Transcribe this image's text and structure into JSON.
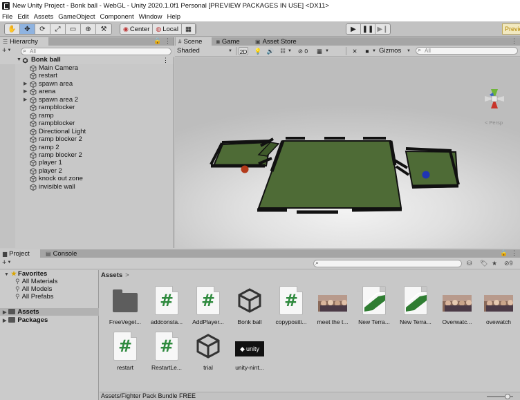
{
  "window": {
    "title": "New Unity Project - Bonk ball - WebGL - Unity 2020.1.0f1 Personal [PREVIEW PACKAGES IN USE] <DX11>"
  },
  "menu": [
    "File",
    "Edit",
    "Assets",
    "GameObject",
    "Component",
    "Window",
    "Help"
  ],
  "toolbar": {
    "center_label": "Center",
    "local_label": "Local",
    "preview_label": "Previe"
  },
  "hierarchy": {
    "tab_label": "Hierarchy",
    "search_placeholder": "All",
    "scene_name": "Bonk ball",
    "items": [
      {
        "name": "Main Camera",
        "expandable": false
      },
      {
        "name": "restart",
        "expandable": false
      },
      {
        "name": "spawn area",
        "expandable": true
      },
      {
        "name": "arena",
        "expandable": true
      },
      {
        "name": "spawn area 2",
        "expandable": true
      },
      {
        "name": "rampblocker",
        "expandable": false
      },
      {
        "name": "ramp",
        "expandable": false
      },
      {
        "name": "rampblocker",
        "expandable": false
      },
      {
        "name": "Directional Light",
        "expandable": false
      },
      {
        "name": "ramp blocker 2",
        "expandable": false
      },
      {
        "name": "ramp 2",
        "expandable": false
      },
      {
        "name": "ramp blocker 2",
        "expandable": false
      },
      {
        "name": "player 1",
        "expandable": false
      },
      {
        "name": "player 2",
        "expandable": false
      },
      {
        "name": "knock out zone",
        "expandable": false
      },
      {
        "name": "invisible wall",
        "expandable": false
      }
    ]
  },
  "scene_view": {
    "tabs": [
      "Scene",
      "Game",
      "Asset Store"
    ],
    "draw_mode": "Shaded",
    "mode_2d": "2D",
    "hidden_count": "0",
    "gizmos_label": "Gizmos",
    "search_placeholder": "All",
    "gizmo_label": "< Persp",
    "colors": {
      "floor": "#4e6b36",
      "wall": "#111111",
      "ball_red": "#b33a1a",
      "ball_blue": "#1f33b3"
    }
  },
  "project": {
    "tabs": [
      "Project",
      "Console"
    ],
    "visible_count": "9",
    "favorites_label": "Favorites",
    "favorites": [
      "All Materials",
      "All Models",
      "All Prefabs"
    ],
    "roots": [
      "Assets",
      "Packages"
    ],
    "breadcrumb": "Assets",
    "assets": [
      {
        "label": "FreeVeget...",
        "kind": "folder"
      },
      {
        "label": "addconsta...",
        "kind": "script"
      },
      {
        "label": "AddPlayer...",
        "kind": "script"
      },
      {
        "label": "Bonk ball",
        "kind": "unity"
      },
      {
        "label": "copypositi...",
        "kind": "script"
      },
      {
        "label": "meet the t...",
        "kind": "photo"
      },
      {
        "label": "New Terra...",
        "kind": "terrain"
      },
      {
        "label": "New Terra...",
        "kind": "terrain"
      },
      {
        "label": "Overwatc...",
        "kind": "photo"
      },
      {
        "label": "ovewatch",
        "kind": "photo"
      },
      {
        "label": "restart",
        "kind": "script"
      },
      {
        "label": "RestartLe...",
        "kind": "script"
      },
      {
        "label": "trial",
        "kind": "unity"
      },
      {
        "label": "unity-nint...",
        "kind": "unitylogo"
      }
    ],
    "status_path": "Assets/Fighter Pack Bundle FREE",
    "unity_logo_text": "unity"
  }
}
